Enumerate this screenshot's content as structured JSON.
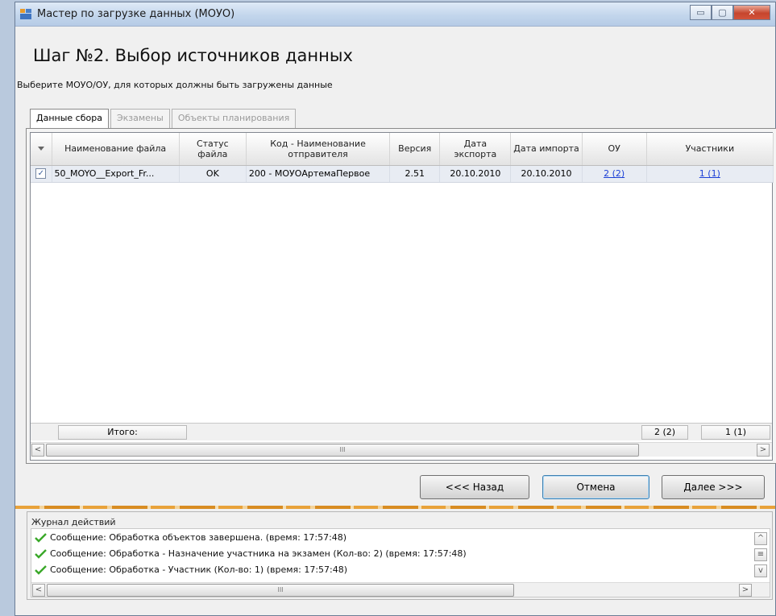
{
  "window": {
    "title": "Мастер по загрузке данных (МОУО)",
    "controls": {
      "minimize": "▭",
      "maximize": "▢",
      "close": "✕"
    }
  },
  "header": {
    "title": "Шаг №2.  Выбор источников данных",
    "subtitle": "Выберите МОУО/ОУ, для которых должны быть загружены данные"
  },
  "tabs": [
    {
      "label": "Данные сбора",
      "active": true
    },
    {
      "label": "Экзамены",
      "active": false
    },
    {
      "label": "Объекты планирования",
      "active": false
    }
  ],
  "grid": {
    "columns": [
      "",
      "Наименование файла",
      "Статус файла",
      "Код - Наименование отправителя",
      "Версия",
      "Дата экспорта",
      "Дата импорта",
      "ОУ",
      "Участники"
    ],
    "rows": [
      {
        "checked": true,
        "check_glyph": "✓",
        "file_name": "50_MOYO__Export_Fr...",
        "status": "OK",
        "sender": "200 - МОУОАртемаПервое",
        "version": "2.51",
        "export_date": "20.10.2010",
        "import_date": "20.10.2010",
        "ou": "2 (2)",
        "participants": "1 (1)"
      }
    ],
    "footer": {
      "label": "Итого:",
      "ou_total": "2 (2)",
      "participants_total": "1 (1)"
    },
    "scroll": {
      "left": "<",
      "right": ">",
      "thumb": "III"
    }
  },
  "buttons": {
    "back": "<<< Назад",
    "cancel": "Отмена",
    "next": "Далее >>>"
  },
  "log": {
    "title": "Журнал действий",
    "messages": [
      "Сообщение: Обработка объектов завершена. (время: 17:57:48)",
      "Сообщение: Обработка - Назначение участника на экзамен (Кол-во: 2) (время: 17:57:48)",
      "Сообщение: Обработка - Участник (Кол-во: 1) (время: 17:57:48)"
    ],
    "scroll": {
      "up": "^",
      "mid": "≡",
      "down": "v",
      "left": "<",
      "right": ">",
      "thumb": "III"
    }
  },
  "colors": {
    "link": "#1b3fd6",
    "ok_check": "#3aa829",
    "titlebar": "#c3d6ec"
  }
}
